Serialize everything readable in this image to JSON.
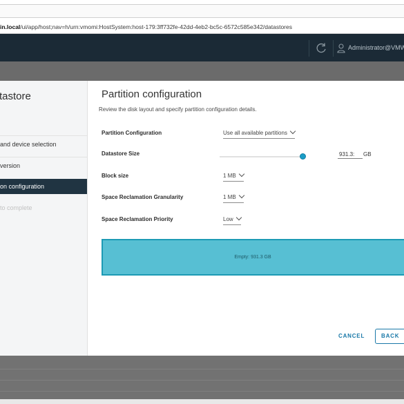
{
  "browser": {
    "url_host": "in.local",
    "url_path": "/ui/app/host;nav=h/urn:vmomi:HostSystem:host-179:3ff732fe-42dd-4eb2-bc5c-6572c585e342/datastores"
  },
  "header": {
    "user": "Administrator@VMW"
  },
  "wizard": {
    "title": "tastore",
    "steps": [
      {
        "label": "and device selection",
        "state": "done"
      },
      {
        "label": "version",
        "state": "done"
      },
      {
        "label": "on configuration",
        "state": "active"
      },
      {
        "label": "to complete",
        "state": "disabled"
      }
    ]
  },
  "main": {
    "title": "Partition configuration",
    "subtitle": "Review the disk layout and specify partition configuration details."
  },
  "form": {
    "partition_configuration": {
      "label": "Partition Configuration",
      "value": "Use all available partitions"
    },
    "datastore_size": {
      "label": "Datastore Size",
      "value": "931.3:",
      "unit": "GB",
      "slider_fraction": 1.0
    },
    "block_size": {
      "label": "Block size",
      "value": "1 MB"
    },
    "space_reclamation_granularity": {
      "label": "Space Reclamation Granularity",
      "value": "1 MB"
    },
    "space_reclamation_priority": {
      "label": "Space Reclamation Priority",
      "value": "Low"
    }
  },
  "partition_bar": {
    "label": "Empty: 931.3 GB",
    "color": "#57bfd3"
  },
  "footer": {
    "cancel": "CANCEL",
    "back": "BACK"
  },
  "colors": {
    "header_bg": "#1b2a36",
    "active_nav_bg": "#203442",
    "accent": "#1978a8",
    "slider": "#1a9dc7"
  }
}
